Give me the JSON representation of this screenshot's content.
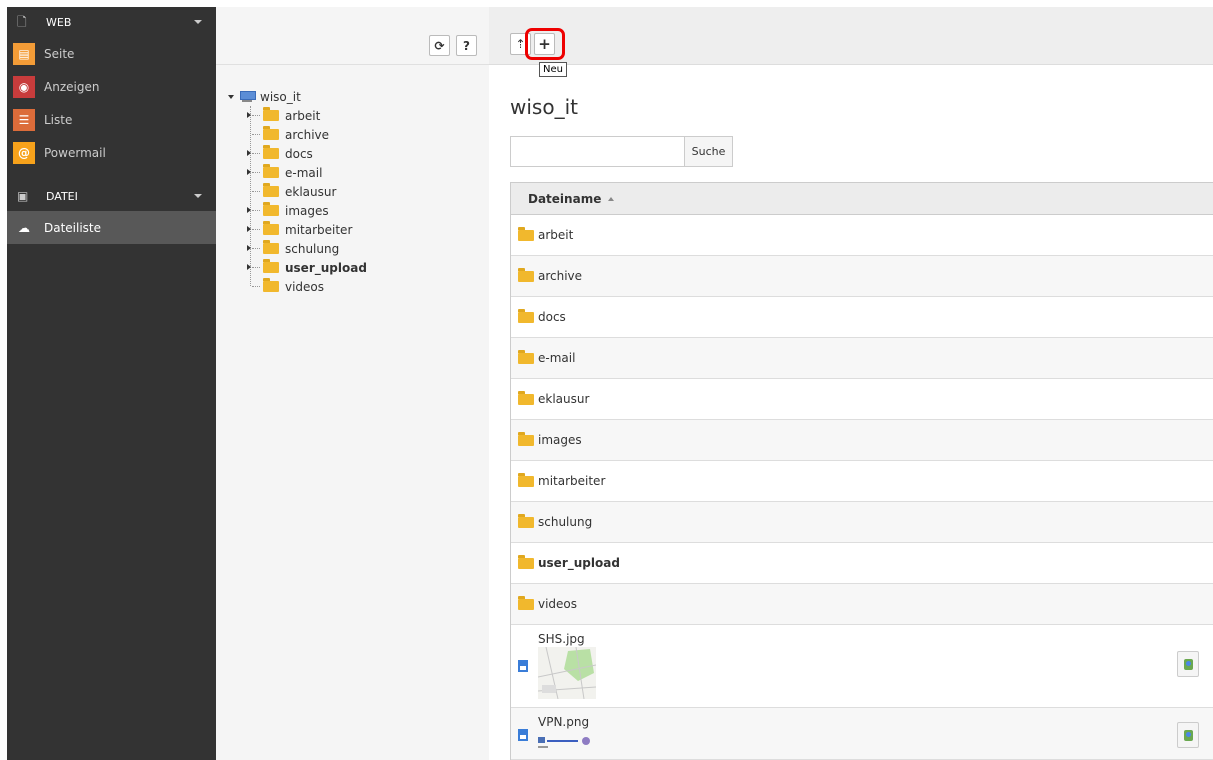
{
  "modules": {
    "web_group": "WEB",
    "web_items": [
      {
        "label": "Seite",
        "icon": "page-icon",
        "color": "#f39c37"
      },
      {
        "label": "Anzeigen",
        "icon": "eye-icon",
        "color": "#c83c3c"
      },
      {
        "label": "Liste",
        "icon": "list-icon",
        "color": "#dc6c3a"
      },
      {
        "label": "Powermail",
        "icon": "powermail-icon",
        "color": "#f7a21b"
      }
    ],
    "datei_group": "DATEI",
    "datei_items": [
      {
        "label": "Dateiliste",
        "icon": "cloud-list-icon",
        "color": "#6aa84f"
      }
    ]
  },
  "tree_toolbar": {
    "refresh": "⟳",
    "help": "?"
  },
  "tree": {
    "root": "wiso_it",
    "nodes": [
      {
        "label": "arbeit",
        "expandable": true
      },
      {
        "label": "archive",
        "expandable": false
      },
      {
        "label": "docs",
        "expandable": true
      },
      {
        "label": "e-mail",
        "expandable": true
      },
      {
        "label": "eklausur",
        "expandable": false
      },
      {
        "label": "images",
        "expandable": true
      },
      {
        "label": "mitarbeiter",
        "expandable": true
      },
      {
        "label": "schulung",
        "expandable": true
      },
      {
        "label": "user_upload",
        "expandable": true
      },
      {
        "label": "videos",
        "expandable": false
      }
    ]
  },
  "toolbar": {
    "upload": "⇡",
    "new": "+",
    "tooltip": "Neu"
  },
  "page_title": "wiso_it",
  "search": {
    "value": "",
    "placeholder": "",
    "button": "Suche"
  },
  "list": {
    "header": "Dateiname",
    "folders": [
      "arbeit",
      "archive",
      "docs",
      "e-mail",
      "eklausur",
      "images",
      "mitarbeiter",
      "schulung",
      "user_upload",
      "videos"
    ],
    "files": [
      "SHS.jpg",
      "VPN.png"
    ]
  }
}
